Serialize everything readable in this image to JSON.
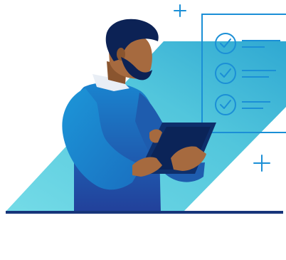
{
  "illustration": {
    "subject": "person-reviewing-checklist-on-tablet",
    "checklist": {
      "items": [
        {
          "checked": true
        },
        {
          "checked": true
        },
        {
          "checked": true
        }
      ]
    },
    "decorations": {
      "plus_signs": 2
    },
    "colors": {
      "teal_light": "#63d4e3",
      "teal_mid": "#46bfd9",
      "navy": "#0e2f6b",
      "navy_dark": "#0b2458",
      "shirt_blue": "#1a8ad1",
      "shirt_shadow": "#1f5fb1",
      "skin": "#a66a3f",
      "skin_dark": "#8a552f",
      "hair": "#0c2255",
      "checklist_line": "#1b8fd6",
      "ground_line": "#17357a",
      "collar": "#e9eef5"
    }
  }
}
